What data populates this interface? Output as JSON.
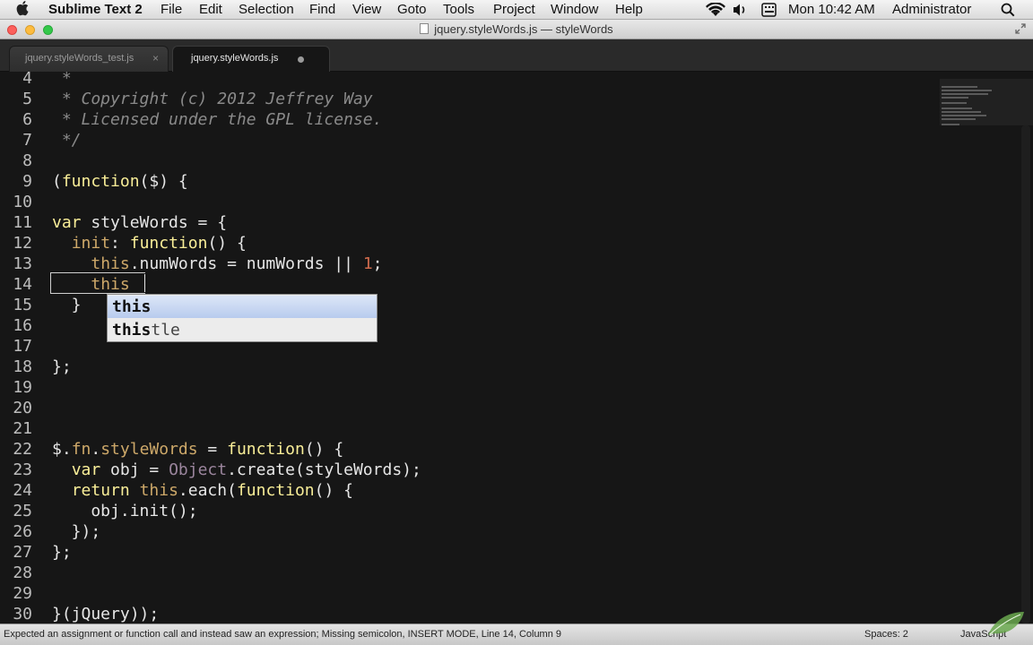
{
  "menubar": {
    "app_name": "Sublime Text 2",
    "items": [
      "File",
      "Edit",
      "Selection",
      "Find",
      "View",
      "Goto",
      "Tools",
      "Project",
      "Window",
      "Help"
    ],
    "clock": "Mon 10:42 AM",
    "user": "Administrator",
    "icons": [
      "apple-icon",
      "wifi-icon",
      "volume-icon",
      "keyboard-input-icon",
      "search-icon"
    ]
  },
  "window": {
    "title": "jquery.styleWords.js — styleWords",
    "traffic_colors": [
      "#fc605c",
      "#fdbc40",
      "#34c84a"
    ]
  },
  "tabs": [
    {
      "label": "jquery.styleWords_test.js",
      "close": "×",
      "active": false
    },
    {
      "label": "jquery.styleWords.js",
      "active": true,
      "modified": true
    }
  ],
  "editor": {
    "line_numbers": [
      "4",
      "5",
      "6",
      "7",
      "8",
      "9",
      "10",
      "11",
      "12",
      "13",
      "14",
      "15",
      "16",
      "17",
      "18",
      "19",
      "20",
      "21",
      "22",
      "23",
      "24",
      "25",
      "26",
      "27",
      "28",
      "29",
      "30"
    ],
    "lines": {
      "l4": " *",
      "l5": " * Copyright (c) 2012 Jeffrey Way",
      "l6": " * Licensed under the GPL license.",
      "l7": " */",
      "l9_a": "(",
      "l9_b": "function",
      "l9_c": "($) {",
      "l11_a": "var",
      "l11_b": " styleWords = {",
      "l12_a": "  ",
      "l12_b": "init",
      "l12_c": ": ",
      "l12_d": "function",
      "l12_e": "() {",
      "l13_a": "    ",
      "l13_b": "this",
      "l13_c": ".numWords = numWords || ",
      "l13_d": "1",
      "l13_e": ";",
      "l14_a": "    ",
      "l14_b": "this",
      "l15": "  }",
      "l18": "};",
      "l22_a": "$.",
      "l22_b": "fn",
      "l22_c": ".",
      "l22_d": "styleWords",
      "l22_e": " = ",
      "l22_f": "function",
      "l22_g": "() {",
      "l23_a": "  ",
      "l23_b": "var",
      "l23_c": " obj = ",
      "l23_d": "Object",
      "l23_e": ".create(styleWords);",
      "l24_a": "  ",
      "l24_b": "return",
      "l24_c": " ",
      "l24_d": "this",
      "l24_e": ".each(",
      "l24_f": "function",
      "l24_g": "() {",
      "l25": "    obj.init();",
      "l26": "  });",
      "l27": "};",
      "l30": "}(jQuery));"
    },
    "syntax_colors": {
      "comment": "#8a8a8a",
      "keyword": "#cda869",
      "function": "#f9ee98",
      "number": "#cf6a4c",
      "object": "#9b859d"
    }
  },
  "autocomplete": {
    "items": [
      {
        "match": "this",
        "rest": "",
        "selected": true
      },
      {
        "match": "this",
        "rest": "tle",
        "selected": false
      }
    ]
  },
  "status": {
    "message": "Expected an assignment or function call and instead saw an expression; Missing semicolon, INSERT MODE, Line 14, Column 9",
    "spaces": "Spaces: 2",
    "syntax": "JavaScript"
  }
}
